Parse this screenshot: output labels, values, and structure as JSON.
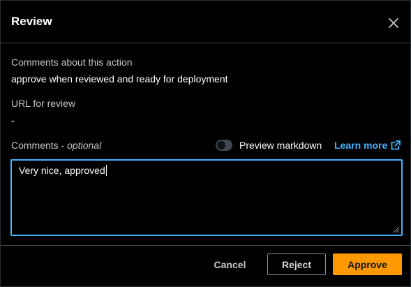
{
  "modal": {
    "title": "Review",
    "close_icon": "close-icon"
  },
  "fields": {
    "comments_about_label": "Comments about this action",
    "comments_about_value": "approve when reviewed and ready for deployment",
    "url_label": "URL for review",
    "url_value": "-"
  },
  "comments_input": {
    "label": "Comments",
    "label_separator": " - ",
    "optional_text": "optional",
    "value": "Very nice, approved",
    "preview_toggle_label": "Preview markdown",
    "preview_toggle_on": false,
    "learn_more_label": "Learn more",
    "learn_more_icon": "external-link-icon"
  },
  "footer": {
    "cancel_label": "Cancel",
    "reject_label": "Reject",
    "approve_label": "Approve"
  },
  "colors": {
    "background": "#000000",
    "focus_border": "#42b4ff",
    "link": "#42b4ff",
    "primary_button": "#ff9900",
    "secondary_text": "#c6c6cd",
    "divider": "#414750"
  }
}
